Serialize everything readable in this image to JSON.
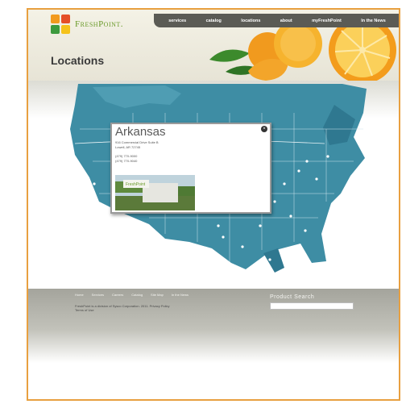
{
  "brand": {
    "name": "FreshPoint."
  },
  "nav": {
    "items": [
      "services",
      "catalog",
      "locations",
      "about",
      "myFreshPoint",
      "In the News"
    ]
  },
  "page": {
    "title": "Locations"
  },
  "popup": {
    "title": "Arkansas",
    "address_1": "916 Commercial Drive Suite B",
    "address_2": "Lowell, AR 72745",
    "phone": "(479) 770-9000",
    "fax": "(479) 770-9040",
    "photo_sign": "FreshPoint"
  },
  "footer": {
    "links": [
      "Home",
      "Services",
      "Careers",
      "Catalog",
      "Site Map",
      "In the News"
    ],
    "copyright_1": "FreshPoint is a division of Sysco Corporation. 2011. Privacy Policy",
    "copyright_2": "Terms of Use",
    "search_label": "Product Search"
  },
  "colors": {
    "accent_border": "#e8a040",
    "nav_bg": "#5b5b55",
    "map_ocean": "#3e8da4",
    "map_land": "#2f7890",
    "footer_bg": "#a4a49c",
    "brand_green": "#6a9a2a"
  }
}
